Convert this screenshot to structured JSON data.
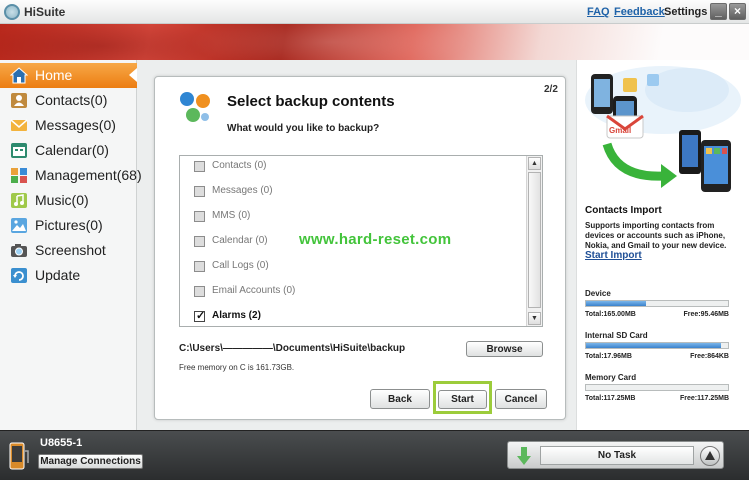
{
  "app": {
    "title": "HiSuite"
  },
  "toplinks": {
    "faq": "FAQ",
    "feedback": "Feedback",
    "settings": "Settings"
  },
  "window_controls": {
    "minimize": "_",
    "close": "×"
  },
  "sidebar": {
    "items": [
      {
        "label": "Home",
        "icon": "home-icon",
        "active": true
      },
      {
        "label": "Contacts(0)",
        "icon": "contacts-icon"
      },
      {
        "label": "Messages(0)",
        "icon": "messages-icon"
      },
      {
        "label": "Calendar(0)",
        "icon": "calendar-icon"
      },
      {
        "label": "Management(68)",
        "icon": "management-icon"
      },
      {
        "label": "Music(0)",
        "icon": "music-icon"
      },
      {
        "label": "Pictures(0)",
        "icon": "pictures-icon"
      },
      {
        "label": "Screenshot",
        "icon": "camera-icon"
      },
      {
        "label": "Update",
        "icon": "update-icon"
      }
    ]
  },
  "dialog": {
    "title": "Select backup contents",
    "subtitle": "What would you like to backup?",
    "page": "2/2",
    "items": [
      {
        "label": "Contacts (0)",
        "checked": false
      },
      {
        "label": "Messages (0)",
        "checked": false
      },
      {
        "label": "MMS (0)",
        "checked": false
      },
      {
        "label": "Calendar (0)",
        "checked": false
      },
      {
        "label": "Call Logs (0)",
        "checked": false
      },
      {
        "label": "Email Accounts (0)",
        "checked": false
      },
      {
        "label": "Alarms (2)",
        "checked": true
      }
    ],
    "watermark": "www.hard-reset.com",
    "path": "C:\\Users\\—————\\Documents\\HiSuite\\backup",
    "browse_label": "Browse",
    "free_memory": "Free memory on C is 161.73GB.",
    "back_label": "Back",
    "start_label": "Start",
    "cancel_label": "Cancel"
  },
  "import": {
    "title": "Contacts Import",
    "description": "Supports importing contacts from devices or accounts such as iPhone, Nokia, and Gmail to your new device.",
    "link": "Start Import",
    "art_label": "Gmail"
  },
  "storage": {
    "device": {
      "label": "Device",
      "total": "Total:165.00MB",
      "free": "Free:95.46MB",
      "used_fraction": 0.42
    },
    "sd": {
      "label": "Internal SD Card",
      "total": "Total:17.96MB",
      "free": "Free:864KB",
      "used_fraction": 0.95
    },
    "memory": {
      "label": "Memory Card",
      "total": "Total:117.25MB",
      "free": "Free:117.25MB",
      "used_fraction": 0.0
    }
  },
  "bottom": {
    "device_name": "U8655-1",
    "manage_label": "Manage Connections",
    "task_label": "No Task"
  },
  "colors": {
    "accent_orange": "#f0901f",
    "highlight_green": "#9ccc3b",
    "watermark_green": "#43c43b",
    "link_blue": "#1f62a8"
  }
}
